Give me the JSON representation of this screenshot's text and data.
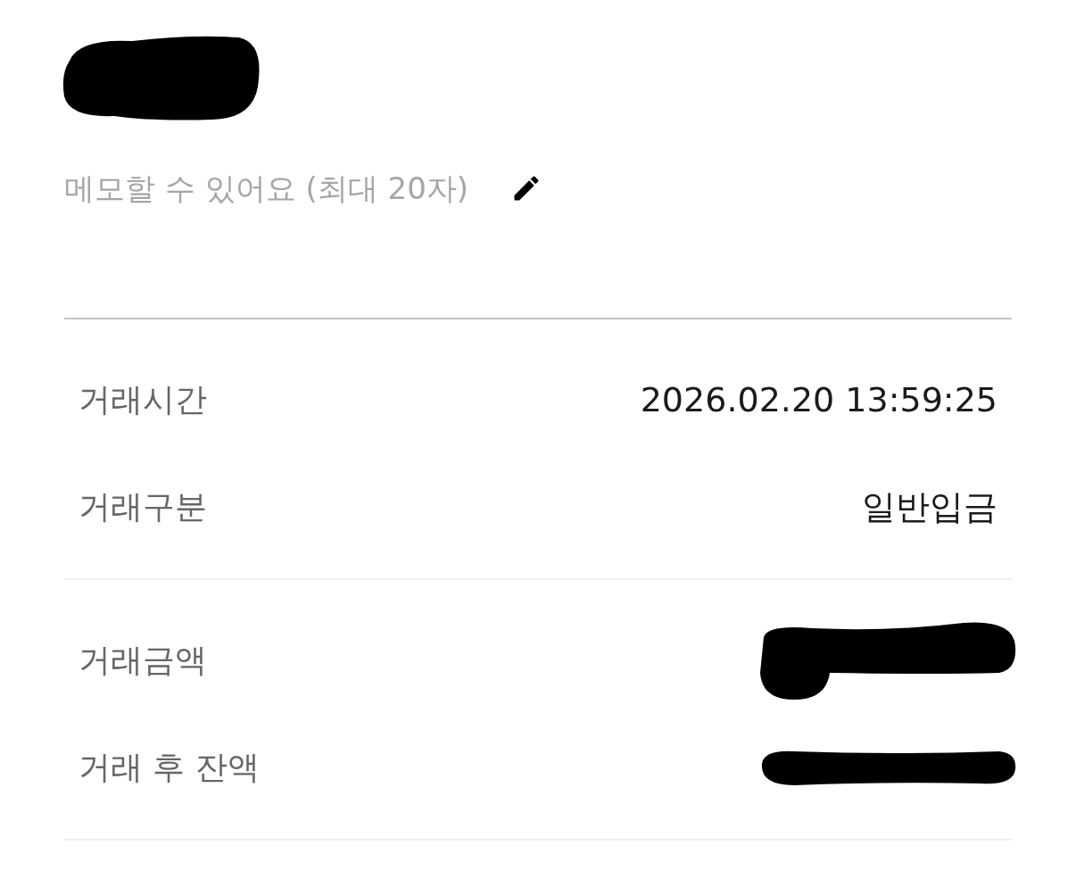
{
  "title": {
    "kind": "redacted"
  },
  "memo": {
    "placeholder": "메모할 수 있어요 (최대 20자)"
  },
  "sections": [
    {
      "rows": [
        {
          "label": "거래시간",
          "kind": "text",
          "value": "2026.02.20 13:59:25"
        },
        {
          "label": "거래구분",
          "kind": "text",
          "value": "일반입금"
        }
      ]
    },
    {
      "rows": [
        {
          "label": "거래금액",
          "kind": "redacted"
        },
        {
          "label": "거래 후 잔액",
          "kind": "redacted"
        }
      ]
    }
  ]
}
